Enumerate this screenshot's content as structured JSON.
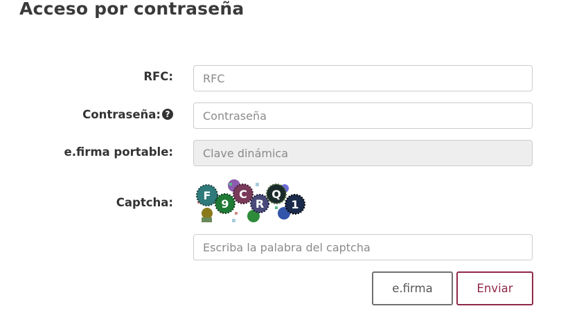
{
  "page": {
    "title": "Acceso por contraseña"
  },
  "form": {
    "rfc": {
      "label": "RFC:",
      "placeholder": "RFC",
      "value": ""
    },
    "password": {
      "label": "Contraseña:",
      "help_icon": "question-circle-icon",
      "placeholder": "Contraseña",
      "value": ""
    },
    "efirma_portable": {
      "label": "e.firma portable:",
      "placeholder": "Clave dinámica",
      "value": "",
      "disabled": true
    },
    "captcha": {
      "label": "Captcha:",
      "code": "F9CRQ1",
      "placeholder": "Escriba la palabra del captcha",
      "value": ""
    }
  },
  "buttons": {
    "efirma": "e.firma",
    "enviar": "Enviar"
  },
  "colors": {
    "accent": "#8f2947",
    "label_text": "#333333",
    "input_border": "#cccccc",
    "disabled_bg": "#eeeeee"
  }
}
